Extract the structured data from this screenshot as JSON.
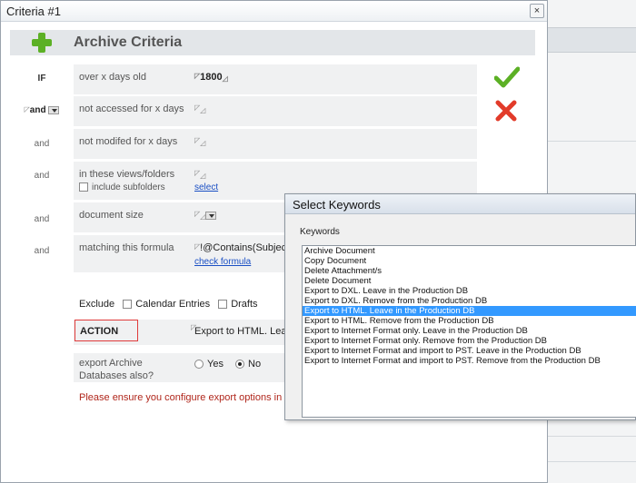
{
  "dialog": {
    "title": "Criteria #1",
    "close": "×",
    "header_title": "Archive Criteria"
  },
  "criteria": [
    {
      "conj": "IF",
      "label": "over x days old",
      "value": "1800"
    },
    {
      "conj": "and",
      "label": "not accessed for x days",
      "value": ""
    },
    {
      "conj": "and",
      "label": "not modifed for x days",
      "value": ""
    },
    {
      "conj": "and",
      "label": "in these views/folders",
      "sub": "include subfolders",
      "link": "select"
    },
    {
      "conj": "and",
      "label": "document size",
      "value": ""
    },
    {
      "conj": "and",
      "label": "matching this formula",
      "value": "!@Contains(Subject;",
      "link": "check formula"
    }
  ],
  "exclude": {
    "label": "Exclude",
    "calendar": "Calendar Entries",
    "drafts": "Drafts"
  },
  "action": {
    "label": "ACTION",
    "value": "Export to HTML. Leav"
  },
  "export_db": {
    "label": "export Archive Databases also?",
    "yes": "Yes",
    "no": "No",
    "selected": "No"
  },
  "warning": "Please ensure you configure export options in the",
  "keywords_dialog": {
    "title": "Select Keywords",
    "group": "Keywords",
    "items": [
      "Archive Document",
      "Copy Document",
      "Delete Attachment/s",
      "Delete Document",
      "Export to DXL. Leave in the Production DB",
      "Export to DXL. Remove from the Production DB",
      "Export to HTML. Leave in the Production DB",
      "Export to HTML. Remove from the Production DB",
      "Export to Internet Format only. Leave in the Production DB",
      "Export to Internet Format only. Remove from the Production DB",
      "Export to Internet Format and import to PST. Leave in the Production DB",
      "Export to Internet Format and import to PST. Remove from the Production DB"
    ],
    "selected_index": 6
  },
  "colors": {
    "accent_green": "#5cb025",
    "delete_red": "#e23b2a",
    "warning_red": "#b0261b",
    "selection_blue": "#3399ff"
  }
}
